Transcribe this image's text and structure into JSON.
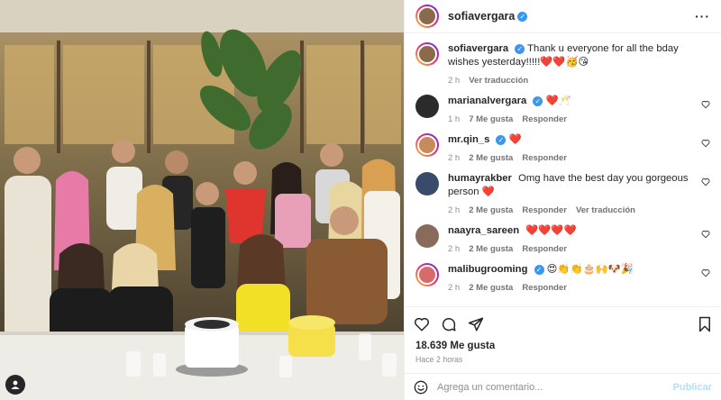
{
  "post": {
    "author": "sofiavergara",
    "caption": "Thank u everyone for all the bday wishes yesterday!!!!!❤️❤️🥳😘",
    "caption_time": "2 h",
    "see_translation": "Ver traducción",
    "likes": "18.639 Me gusta",
    "posted_ago": "Hace 2 horas"
  },
  "comments": [
    {
      "user": "marianalvergara",
      "verified": true,
      "text": "❤️🥂",
      "time": "1 h",
      "likes": "7 Me gusta",
      "reply": "Responder",
      "avatar_color": "#2b2b2b",
      "ring": false
    },
    {
      "user": "mr.qin_s",
      "verified": true,
      "text": "❤️",
      "time": "2 h",
      "likes": "2 Me gusta",
      "reply": "Responder",
      "avatar_color": "#c78a5a",
      "ring": true
    },
    {
      "user": "humayrakber",
      "verified": false,
      "text": "Omg have the best day you gorgeous person ❤️",
      "time": "2 h",
      "likes": "2 Me gusta",
      "reply": "Responder",
      "translate": "Ver traducción",
      "avatar_color": "#3a4a6b",
      "ring": false
    },
    {
      "user": "naayra_sareen",
      "verified": false,
      "text": "❤️❤️❤️❤️",
      "time": "2 h",
      "likes": "2 Me gusta",
      "reply": "Responder",
      "avatar_color": "#8a6a5a",
      "ring": false
    },
    {
      "user": "malibugrooming",
      "verified": true,
      "text": "😍👏👏🎂🙌🐶🎉",
      "time": "2 h",
      "likes": "2 Me gusta",
      "reply": "Responder",
      "avatar_color": "#d96a6a",
      "ring": true
    }
  ],
  "composer": {
    "placeholder": "Agrega un comentario...",
    "publish": "Publicar"
  },
  "icons": {
    "like": "heart-icon",
    "comment": "comment-icon",
    "share": "send-icon",
    "save": "bookmark-icon",
    "emoji": "emoji-icon",
    "tag": "user-tag-icon",
    "more": "more-icon"
  },
  "colors": {
    "verified": "#3897f0",
    "publish_disabled": "#b2dffc",
    "muted": "#8e8e8e",
    "story_ring_start": "#f9ce34",
    "story_ring_end": "#6228d7"
  }
}
